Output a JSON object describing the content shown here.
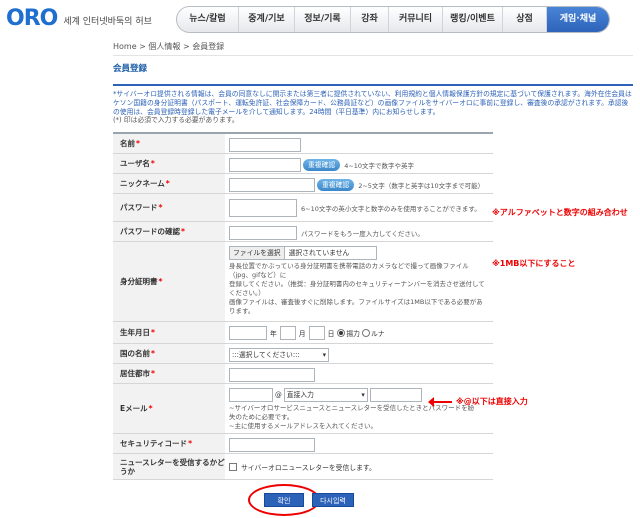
{
  "header": {
    "logo": "ORO",
    "logo_text": "세계 인터넷바둑의 허브",
    "nav": [
      "뉴스/칼럼",
      "중계/기보",
      "정보/기록",
      "강좌",
      "커뮤니티",
      "랭킹/이벤트",
      "상점",
      "게임·채널"
    ],
    "active_nav": "게임·채널"
  },
  "breadcrumb": "Home > 個人情報 > 会員登録",
  "page_title": "会員登録",
  "notice": "*サイバーオロ提供される情報は、会員の同意なしに開示または第三者に提供されていない、利用規約と個人情報保護方針の規定に基づいて保護されます。海外在住会員はケソン国籍の身分証明書（パスポート、運転免許証、社会保障カード、公務員証など）の画像ファイルをサイバーオロに事前に登録し、審査後の承認がされます。承認後の使用は、会員登録時登録した電子メールを介して通知します。24時間（平日基準）内にお知らせします。",
  "required_note": "(*) 印は必須で入力する必要があります。",
  "form": {
    "name": {
      "label": "名前"
    },
    "username": {
      "label": "ユーザ名",
      "check": "重複確認",
      "hint": "4~10文字で数字や英字"
    },
    "nickname": {
      "label": "ニックネーム",
      "check": "重複確認",
      "hint": "2~5文字（数字と英字は10文字まで可能）"
    },
    "password": {
      "label": "パスワード",
      "hint": "6~10文字の英小文字と数字のみを使用することができます。"
    },
    "password_confirm": {
      "label": "パスワードの確認",
      "hint": "パスワードをもう一度入力してください。"
    },
    "id_card": {
      "label": "身分証明書",
      "file_button": "ファイルを選択",
      "file_status": "選択されていません",
      "desc1": "身長位置でかぶっている身分証明書を携帯電話のカメラなどで撮って画像ファイル（jpg、gifなど）に",
      "desc2": "登録してください。（推奨：身分証明書内のセキュリティーナンバーを消去させ送付してください。）",
      "desc3": "画像ファイルは、審査後すぐに削除します。ファイルサイズは1MB以下である必要があります。"
    },
    "birthday": {
      "label": "生年月日",
      "year": "年",
      "month": "月",
      "day": "日",
      "solar": "揚力",
      "lunar": "ルナ"
    },
    "country": {
      "label": "国の名前",
      "selected": ":::選択してください:::"
    },
    "city": {
      "label": "居住都市"
    },
    "email": {
      "label": "Eメール",
      "at": "@",
      "domain_selected": "直接入力",
      "desc1": "~サイバーオロサービスニュースとニュースレターを受信したときとパスワードを紛",
      "desc2": "失のために必要です。",
      "desc3": "~主に使用するメールアドレスを入れてください。"
    },
    "security_code": {
      "label": "セキュリティコード"
    },
    "newsletter": {
      "label": "ニュースレターを受信するかどうか",
      "option": "サイバーオロニュースレターを受信します。"
    }
  },
  "annotations": {
    "password": "※アルファベットと数字の組み合わせ",
    "id_card": "※1MB以下にすること",
    "email": "※@以下は直接入力"
  },
  "actions": {
    "confirm": "확인",
    "reset": "다시입력"
  }
}
